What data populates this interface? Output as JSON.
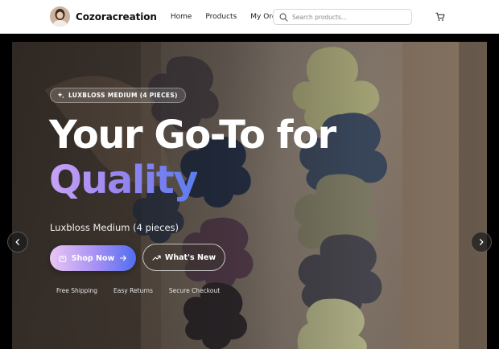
{
  "header": {
    "brand": "Cozoracreation",
    "nav": [
      "Home",
      "Products",
      "My Orders"
    ],
    "search_placeholder": "Search products...",
    "icons": {
      "search": "search-icon",
      "cart": "cart-icon"
    }
  },
  "hero": {
    "badge": "LUXBLOSS MEDIUM (4 PIECES)",
    "title_line1": "Your Go-To for",
    "title_line2": "Quality",
    "subtitle": "Luxbloss Medium (4 pieces)",
    "shop_button": "Shop Now",
    "new_button": "What's New",
    "features": [
      "Free Shipping",
      "Easy Returns",
      "Secure Checkout"
    ],
    "colors": {
      "gradient_start": "#e9c6f5",
      "gradient_mid": "#a58ff3",
      "gradient_end": "#4f6ef2"
    }
  }
}
